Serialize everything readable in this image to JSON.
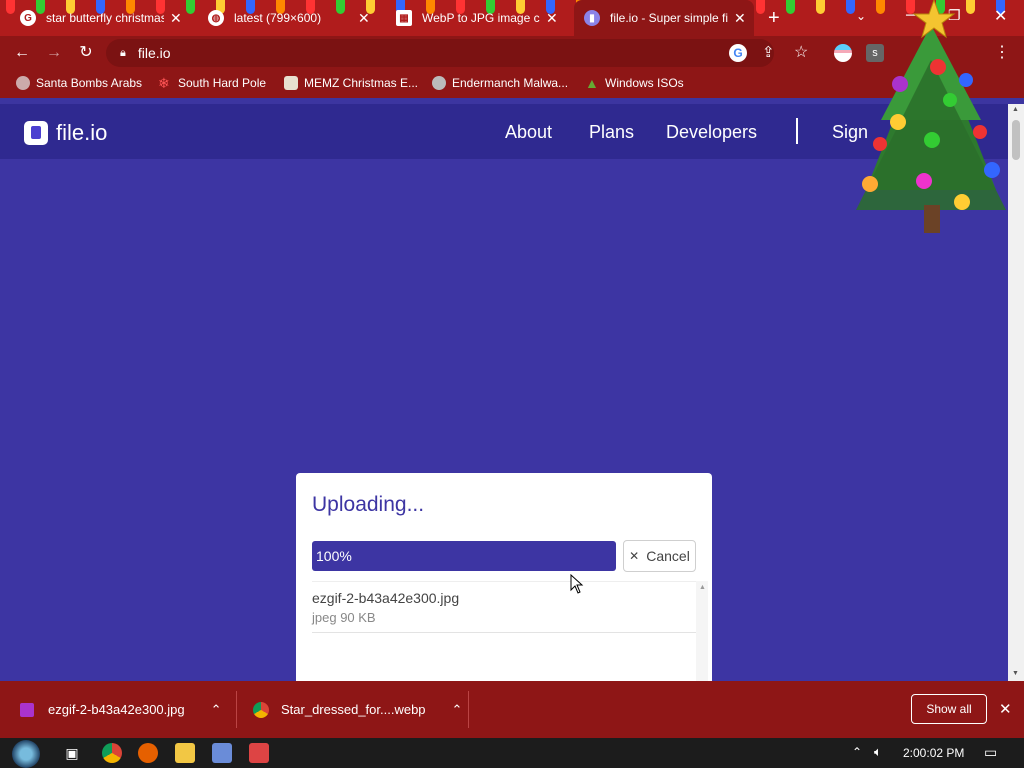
{
  "browser": {
    "tabs": [
      {
        "label": "star butterfly christmas",
        "active": false
      },
      {
        "label": "latest (799×600)",
        "active": false
      },
      {
        "label": "WebP to JPG image co",
        "active": false
      },
      {
        "label": "file.io - Super simple fi",
        "active": true
      }
    ],
    "new_tab_glyph": "+",
    "url": "file.io",
    "bookmarks": [
      "Santa Bombs Arabs",
      "South Hard Pole",
      "MEMZ Christmas E...",
      "Endermanch Malwa...",
      "Windows ISOs"
    ]
  },
  "site": {
    "logo_text": "file.io",
    "nav": [
      "About",
      "Plans",
      "Developers",
      "Sign"
    ]
  },
  "upload": {
    "title": "Uploading...",
    "progress_label": "100%",
    "progress_fraction": 1.0,
    "cancel_label": "Cancel",
    "cancel_glyph": "✕",
    "file_name": "ezgif-2-b43a42e300.jpg",
    "file_meta": "jpeg 90 KB"
  },
  "downloads": {
    "items": [
      "ezgif-2-b43a42e300.jpg",
      "Star_dressed_for....webp"
    ],
    "show_all_label": "Show all"
  },
  "taskbar": {
    "clock": "2:00:02 PM"
  },
  "colors": {
    "chrome_red": "#8e1616",
    "site_blue": "#3d35a3",
    "header_blue": "#2f2990"
  }
}
